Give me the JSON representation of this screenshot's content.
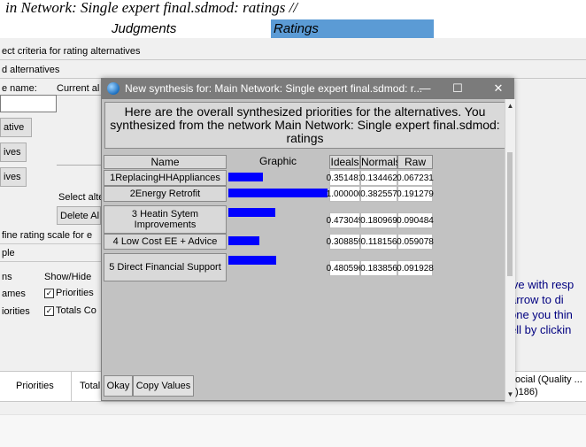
{
  "background": {
    "doc_title": "in Network: Single expert final.sdmod: ratings //",
    "tab_judgments": "Judgments",
    "tab_ratings": "Ratings",
    "select_criteria": "ect criteria for rating alternatives",
    "alternatives_header": "d alternatives",
    "name_label": "e name:",
    "current_label": "Current al",
    "btn_alternative": "ative",
    "btn_ives_1": "ives",
    "btn_ives_2": "ives",
    "select_label": "Select alte",
    "delete_btn": "Delete Al",
    "define_scale": "fine rating scale for e",
    "ple_label": "ple",
    "ns_label": "ns",
    "show_hide_label": "Show/Hide",
    "ames_label": "ames",
    "priorities_cb": "Priorities",
    "iorities_label": "iorities",
    "totals_cb": "Totals Co",
    "priorities_col": "Priorities",
    "total_col": "Total",
    "right_note": [
      "ive with resp",
      "arrow to di",
      "one you thin",
      "ell by clickin"
    ],
    "social_col": "ocial (Quality ...",
    "social_val": ")186)"
  },
  "modal": {
    "title": "New synthesis for: Main Network: Single expert final.sdmod: r...",
    "minimize": "—",
    "maximize": "☐",
    "close": "✕",
    "header_text": "Here are the overall synthesized priorities for the alternatives.  You synthesized from the network Main Network: Single expert final.sdmod: ratings",
    "columns": {
      "name": "Name",
      "graphic": "Graphic",
      "ideals": "Ideals",
      "normals": "Normals",
      "raw": "Raw"
    },
    "rows": [
      {
        "name": "1ReplacingHHAppliances",
        "ideal_fraction": 0.351481,
        "ideals": "0.351481",
        "normals": "0.134462",
        "raw": "0.067231"
      },
      {
        "name": "2Energy Retrofit",
        "ideal_fraction": 1.0,
        "ideals": "1.000000",
        "normals": "0.382557",
        "raw": "0.191279"
      },
      {
        "name": "3 Heatin Sytem Improvements",
        "ideal_fraction": 0.473049,
        "ideals": "0.473049",
        "normals": "0.180969",
        "raw": "0.090484"
      },
      {
        "name": "4 Low Cost EE + Advice",
        "ideal_fraction": 0.308859,
        "ideals": "0.308859",
        "normals": "0.118156",
        "raw": "0.059078"
      },
      {
        "name": "5 Direct Financial Support",
        "ideal_fraction": 0.480596,
        "ideals": "0.480596",
        "normals": "0.183856",
        "raw": "0.091928"
      }
    ],
    "okay_label": "Okay",
    "copy_label": "Copy Values"
  },
  "colors": {
    "accent_tab": "#5b9bd5",
    "bar": "#0000ff",
    "titlebar": "#7b7b7b"
  }
}
